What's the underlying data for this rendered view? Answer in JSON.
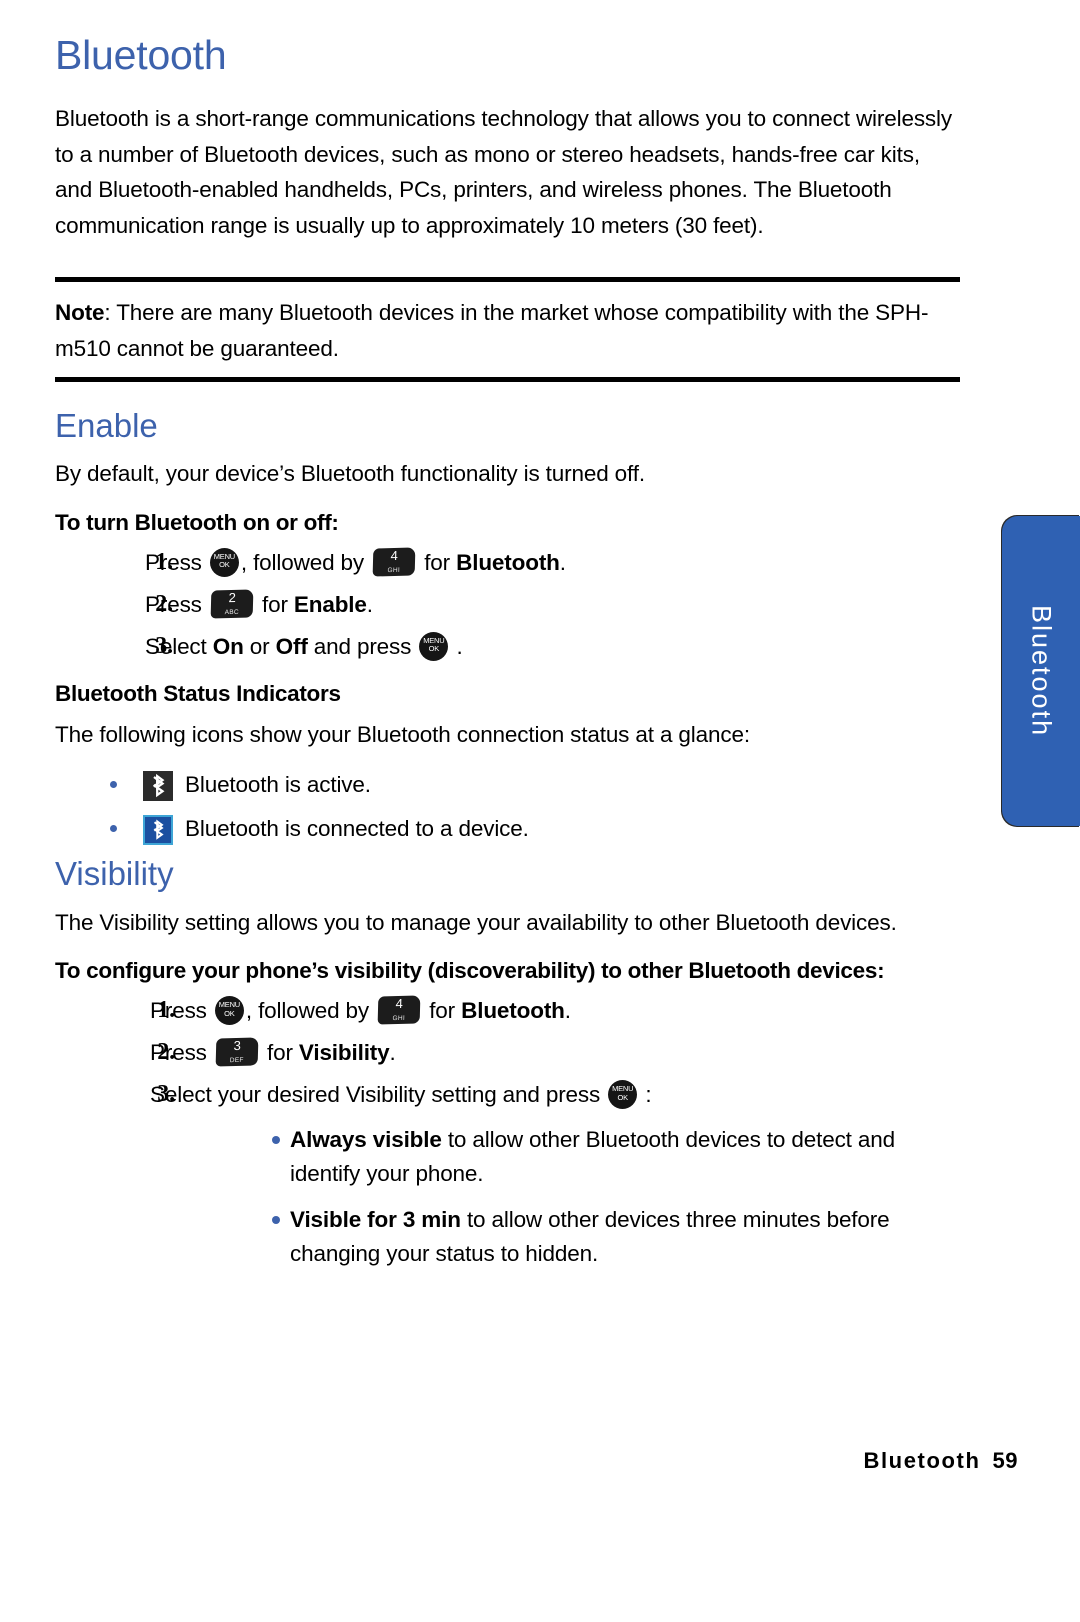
{
  "page": {
    "chapter_title": "Bluetooth",
    "intro": "Bluetooth is a short-range communications technology that allows you to connect wirelessly to a number of Bluetooth devices, such as mono or stereo headsets, hands-free car kits, and Bluetooth-enabled handhelds, PCs, printers, and wireless phones. The Bluetooth communication range is usually up to approximately 10 meters (30 feet)."
  },
  "note": {
    "label": "Note",
    "text": ": There are many Bluetooth devices in the market whose compatibility with the SPH-m510 cannot be guaranteed."
  },
  "enable": {
    "title": "Enable",
    "intro": "By default, your device’s Bluetooth functionality is turned off.",
    "procedure_title": "To turn Bluetooth on or off:",
    "steps": [
      {
        "num": "1.",
        "parts": [
          "Press ",
          ", followed by ",
          " for ",
          "Bluetooth",
          "."
        ],
        "key_menu": {
          "top": "MENU",
          "bottom": "OK"
        },
        "key_digit": {
          "num": "4",
          "letters": "GHI"
        }
      },
      {
        "num": "2.",
        "parts": [
          "Press ",
          " for ",
          "Enable",
          "."
        ],
        "key_digit": {
          "num": "2",
          "letters": "ABC"
        }
      },
      {
        "num": "3.",
        "parts": [
          "Select ",
          "On",
          " or ",
          "Off",
          " and press ",
          " ."
        ],
        "key_menu": {
          "top": "MENU",
          "bottom": "OK"
        }
      }
    ]
  },
  "status_indicators": {
    "title": "Bluetooth Status Indicators",
    "intro": "The following icons show your Bluetooth connection status at a glance:",
    "items": [
      {
        "icon": "bluetooth-active-icon",
        "style": "dark",
        "text": "Bluetooth is active."
      },
      {
        "icon": "bluetooth-connected-icon",
        "style": "blue",
        "text": "Bluetooth is connected to a device."
      }
    ]
  },
  "visibility": {
    "title": "Visibility",
    "intro": "The Visibility setting allows you to manage your availability to other Bluetooth devices.",
    "procedure_title": "To configure your phone’s visibility (discoverability) to other Bluetooth devices:",
    "steps": [
      {
        "num": "1.",
        "parts": [
          "Press ",
          ", followed by ",
          " for ",
          "Bluetooth",
          "."
        ],
        "key_menu": {
          "top": "MENU",
          "bottom": "OK"
        },
        "key_digit": {
          "num": "4",
          "letters": "GHI"
        }
      },
      {
        "num": "2.",
        "parts": [
          "Press ",
          " for ",
          "Visibility",
          "."
        ],
        "key_digit": {
          "num": "3",
          "letters": "DEF"
        }
      },
      {
        "num": "3.",
        "parts": [
          "Select your desired Visibility setting and press ",
          " :"
        ],
        "key_menu": {
          "top": "MENU",
          "bottom": "OK"
        }
      }
    ],
    "options": [
      {
        "label": "Always visible",
        "text": " to allow other Bluetooth devices to detect and identify your phone."
      },
      {
        "label": "Visible for 3 min",
        "text": " to allow other devices three minutes before changing your status to hidden."
      }
    ]
  },
  "side_tab": {
    "label": "Bluetooth"
  },
  "footer": {
    "chapter": "Bluetooth",
    "page_number": "59"
  },
  "colors": {
    "heading_blue": "#3d62ac",
    "tab_blue": "#2f61b3",
    "badge_dark": "#2b2b2b",
    "badge_blue": "#1b4fa0",
    "badge_blue_border": "#3ea5d6"
  }
}
